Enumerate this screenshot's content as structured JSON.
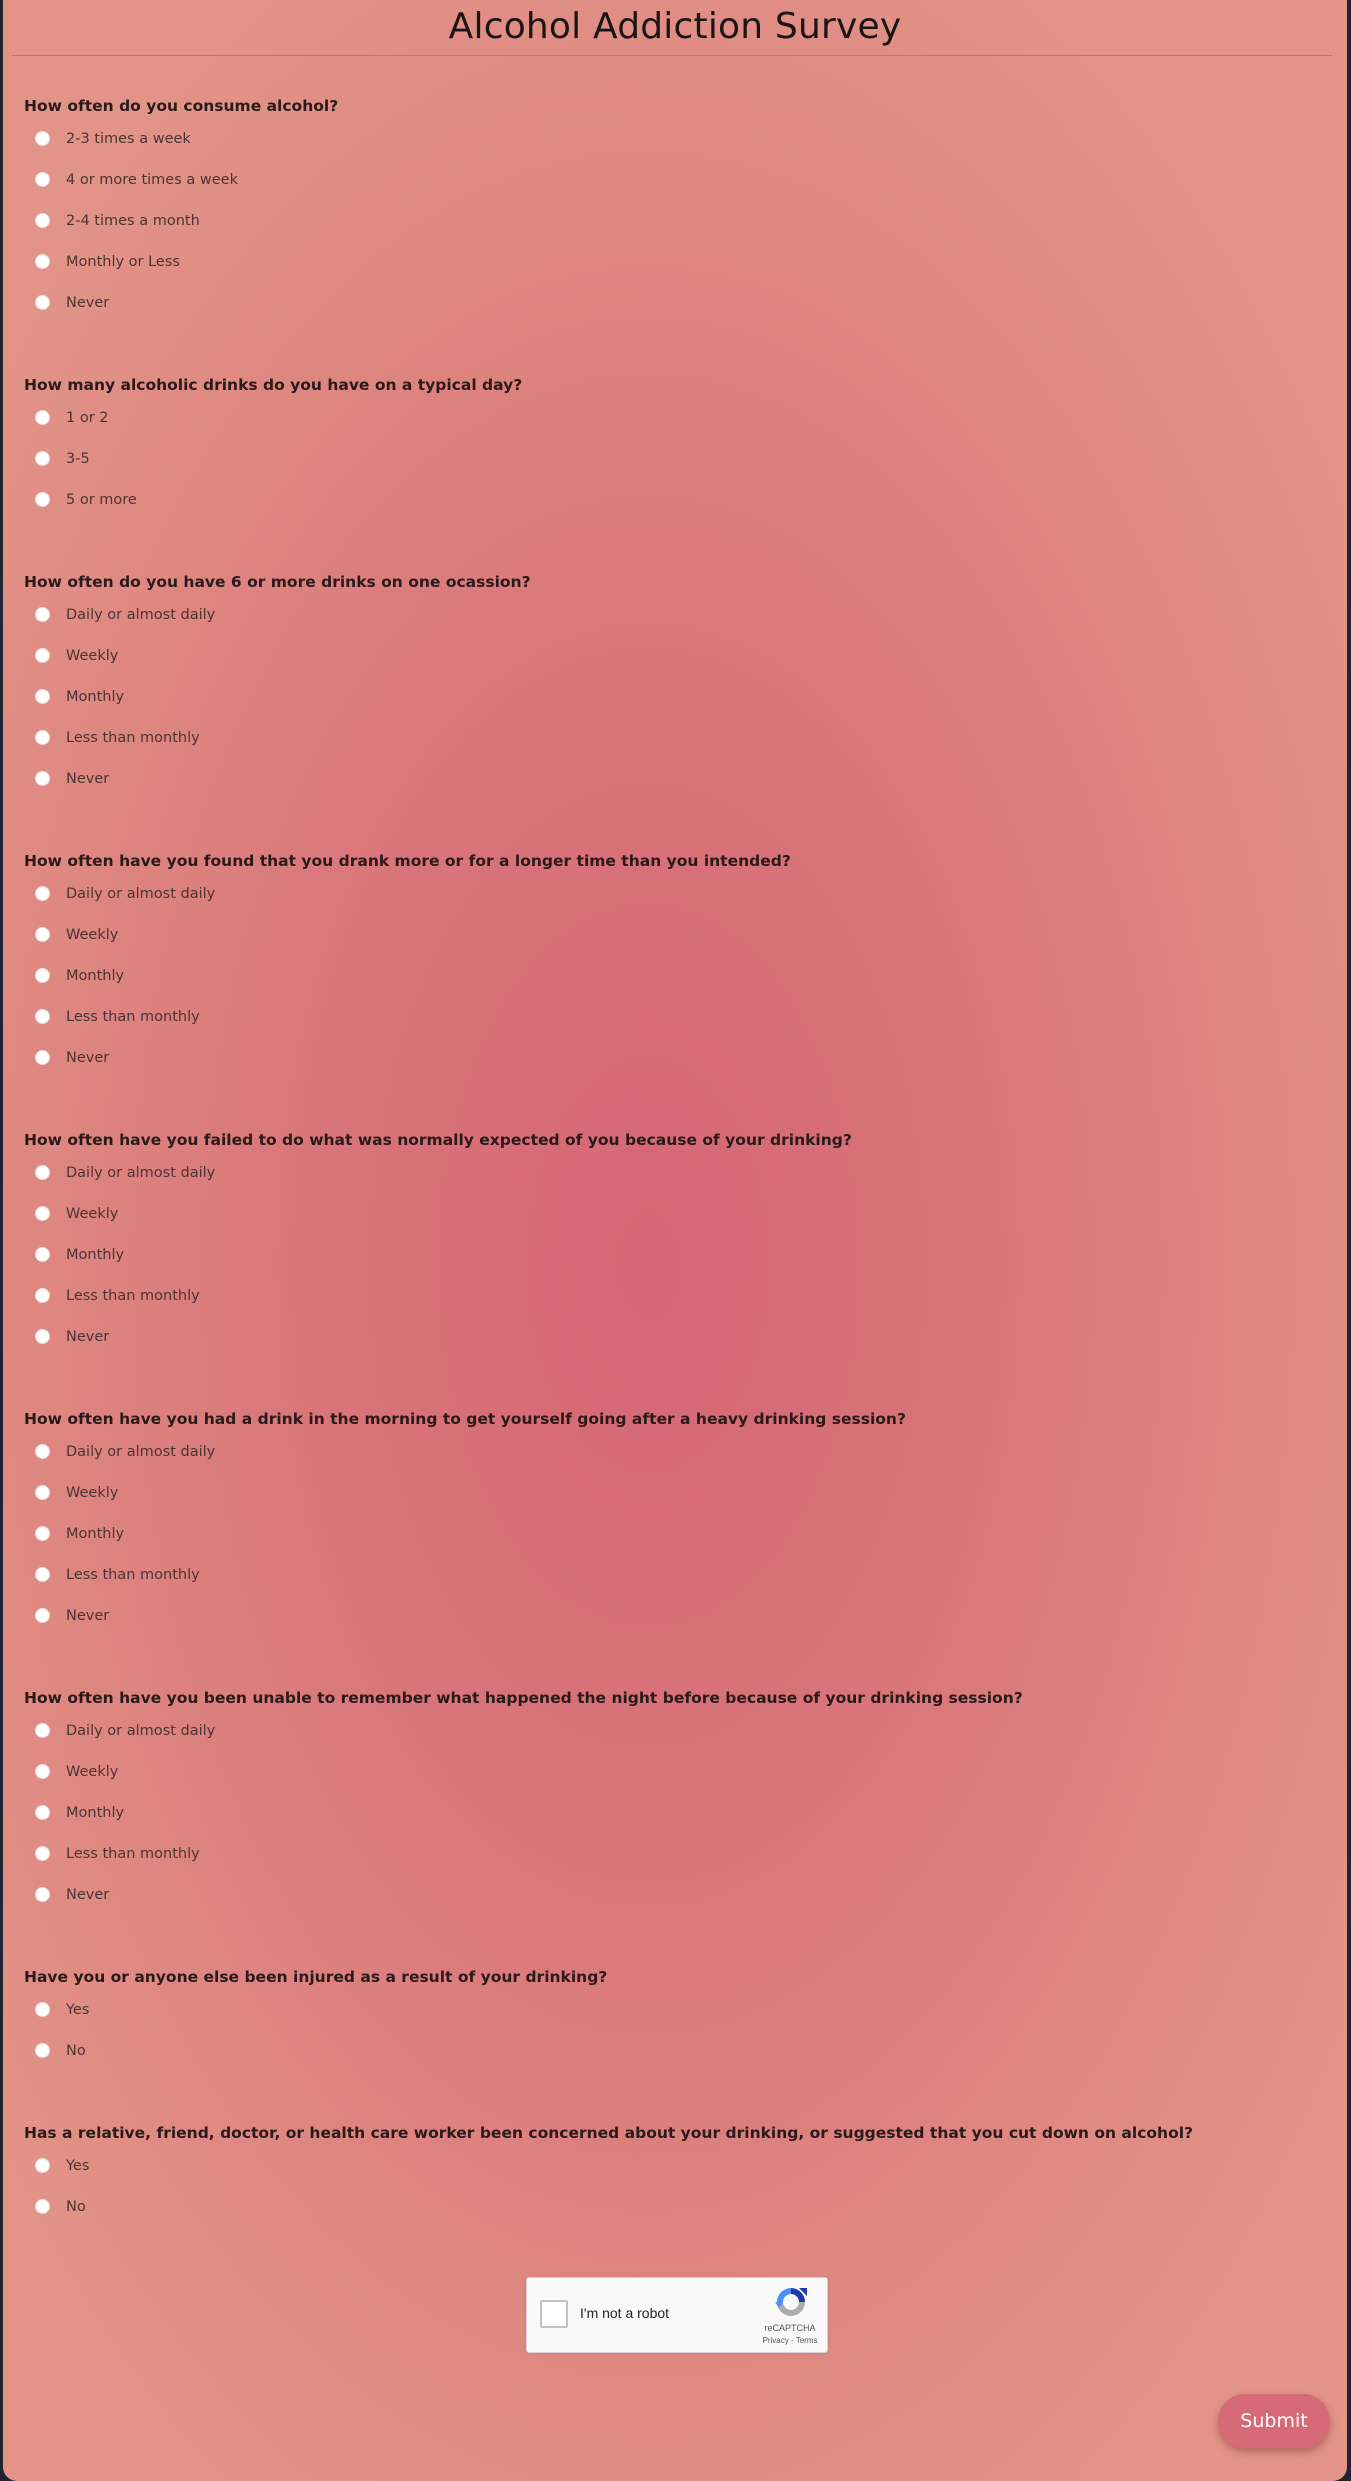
{
  "page": {
    "title": "Alcohol Addiction Survey"
  },
  "questions": [
    {
      "label": "How often do you consume alcohol?",
      "options": [
        "2-3 times a week",
        "4 or more times a week",
        "2-4 times a month",
        "Monthly or Less",
        "Never"
      ]
    },
    {
      "label": "How many alcoholic drinks do you have on a typical day?",
      "options": [
        "1 or 2",
        "3-5",
        "5 or more"
      ]
    },
    {
      "label": "How often do you have 6 or more drinks on one ocassion?",
      "options": [
        "Daily or almost daily",
        "Weekly",
        "Monthly",
        "Less than monthly",
        "Never"
      ]
    },
    {
      "label": "How often have you found that you drank more or for a longer time than you intended?",
      "options": [
        "Daily or almost daily",
        "Weekly",
        "Monthly",
        "Less than monthly",
        "Never"
      ]
    },
    {
      "label": "How often have you failed to do what was normally expected of you because of your drinking?",
      "options": [
        "Daily or almost daily",
        "Weekly",
        "Monthly",
        "Less than monthly",
        "Never"
      ]
    },
    {
      "label": "How often have you had a drink in the morning to get yourself going after a heavy drinking session?",
      "options": [
        "Daily or almost daily",
        "Weekly",
        "Monthly",
        "Less than monthly",
        "Never"
      ]
    },
    {
      "label": "How often have you been unable to remember what happened the night before because of your drinking session?",
      "options": [
        "Daily or almost daily",
        "Weekly",
        "Monthly",
        "Less than monthly",
        "Never"
      ]
    },
    {
      "label": "Have you or anyone else been injured as a result of your drinking?",
      "options": [
        "Yes",
        "No"
      ]
    },
    {
      "label": "Has a relative, friend, doctor, or health care worker been concerned about your drinking, or suggested that you cut down on alcohol?",
      "options": [
        "Yes",
        "No"
      ]
    }
  ],
  "captcha": {
    "label": "I'm not a robot",
    "brand": "reCAPTCHA",
    "links": "Privacy - Terms",
    "checked": false
  },
  "submit": {
    "label": "Submit"
  },
  "colors": {
    "accent": "#d66a76",
    "background_edge": "#e29488",
    "background_center": "#d56674"
  }
}
